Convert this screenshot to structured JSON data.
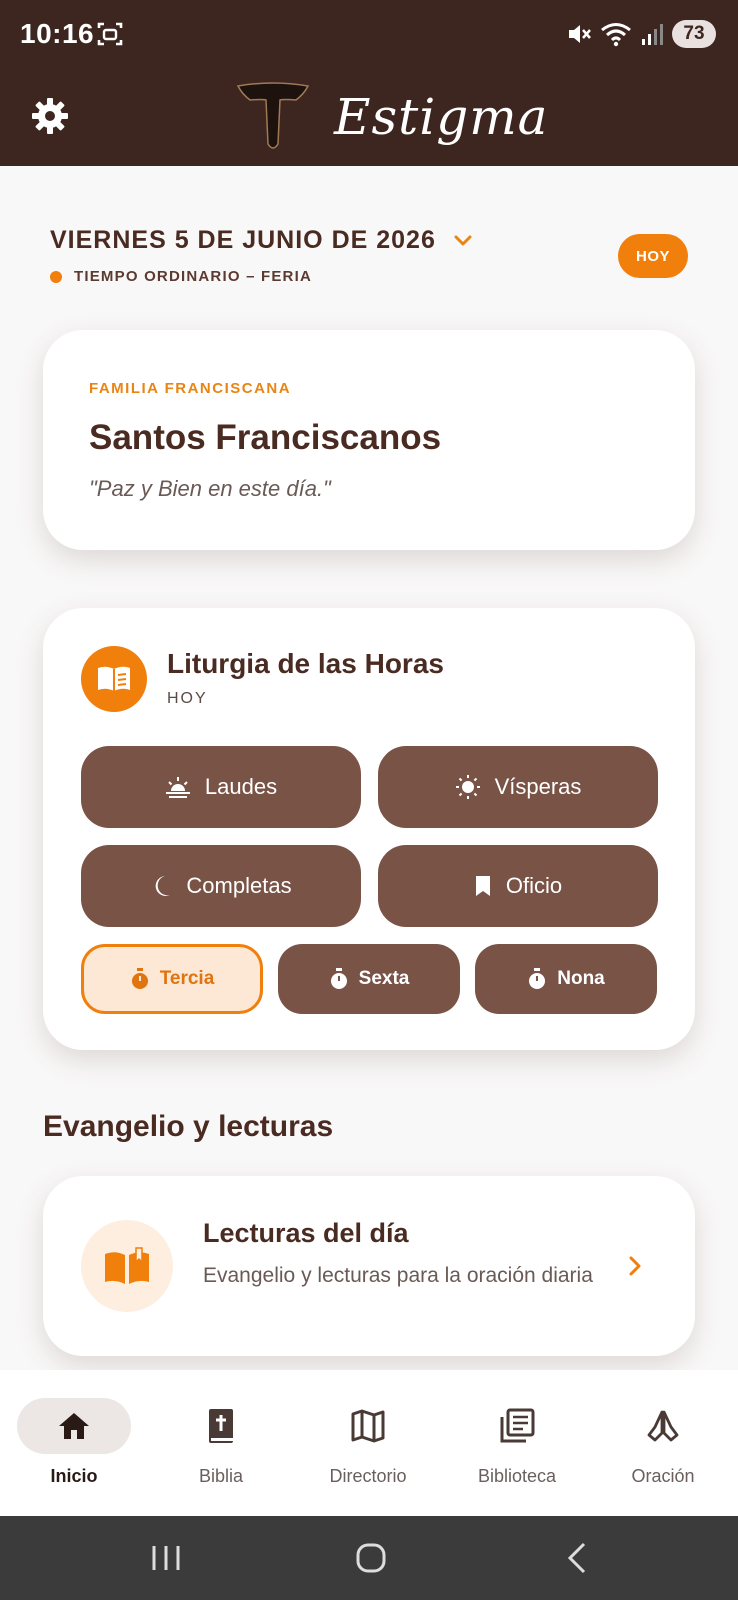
{
  "status_bar": {
    "time": "10:16",
    "battery": "73"
  },
  "app": {
    "title": "Estigma"
  },
  "date": {
    "label": "VIERNES 5 DE JUNIO DE 2026",
    "season": "TIEMPO ORDINARIO – FERIA",
    "today_button": "HOY",
    "season_dot_color": "#f07f0c"
  },
  "saint_card": {
    "kicker": "FAMILIA FRANCISCANA",
    "title": "Santos Franciscanos",
    "quote": "\"Paz y Bien en este día.\""
  },
  "liturgy": {
    "title": "Liturgia de las Horas",
    "subtitle": "HOY",
    "icon": "open-book-icon",
    "hours": [
      {
        "label": "Laudes",
        "icon": "sunrise-icon"
      },
      {
        "label": "Vísperas",
        "icon": "sun-icon"
      },
      {
        "label": "Completas",
        "icon": "moon-icon"
      },
      {
        "label": "Oficio",
        "icon": "bookmark-icon"
      }
    ],
    "minor_hours": [
      {
        "label": "Tercia",
        "icon": "stopwatch-icon",
        "selected": true
      },
      {
        "label": "Sexta",
        "icon": "stopwatch-icon",
        "selected": false
      },
      {
        "label": "Nona",
        "icon": "stopwatch-icon",
        "selected": false
      }
    ]
  },
  "readings_section": {
    "title": "Evangelio y lecturas",
    "card_title": "Lecturas del día",
    "card_desc": "Evangelio y lecturas para la oración diaria"
  },
  "bottom_nav": [
    {
      "label": "Inicio",
      "icon": "home-icon",
      "active": true
    },
    {
      "label": "Biblia",
      "icon": "bible-icon",
      "active": false
    },
    {
      "label": "Directorio",
      "icon": "map-icon",
      "active": false
    },
    {
      "label": "Biblioteca",
      "icon": "library-icon",
      "active": false
    },
    {
      "label": "Oración",
      "icon": "praying-hands-icon",
      "active": false
    }
  ],
  "colors": {
    "header_bg": "#3d2520",
    "accent": "#f07f0c",
    "hour_button": "#7a5347",
    "text_dark": "#4a2b22"
  }
}
